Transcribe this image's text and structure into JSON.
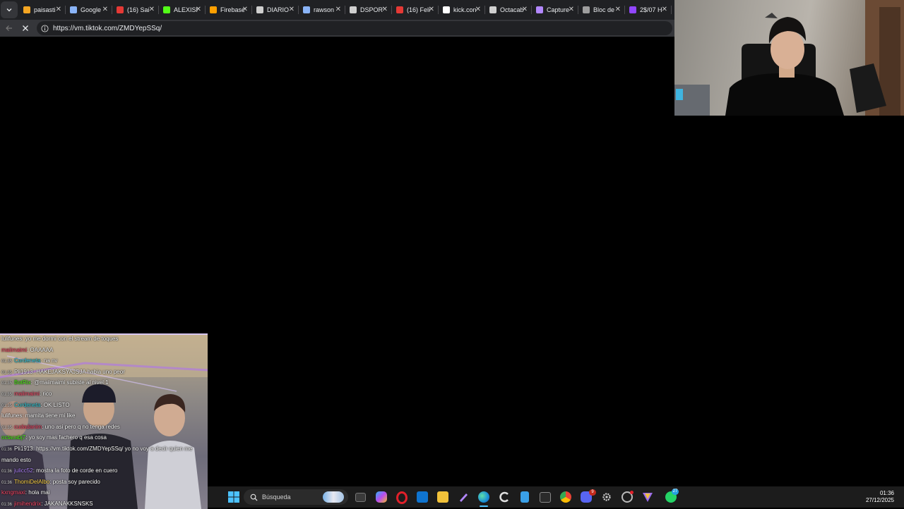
{
  "browser": {
    "tabs": [
      {
        "label": "paisasti",
        "color": "#f5a623"
      },
      {
        "label": "Google",
        "color": "#8ab4f8"
      },
      {
        "label": "(16) Sai",
        "color": "#e53935"
      },
      {
        "label": "ALEXISF",
        "color": "#53fc18"
      },
      {
        "label": "Firebase",
        "color": "#ffa000"
      },
      {
        "label": "DIARIO",
        "color": "#cfcfcf"
      },
      {
        "label": "rawson",
        "color": "#8ab4f8"
      },
      {
        "label": "DSPORT",
        "color": "#cfcfcf"
      },
      {
        "label": "(16) Feli",
        "color": "#e53935"
      },
      {
        "label": "kick.con",
        "color": "#ffffff"
      },
      {
        "label": "Octacab",
        "color": "#cfcfcf"
      },
      {
        "label": "Capture",
        "color": "#b388ff"
      },
      {
        "label": "Bloc de",
        "color": "#9e9e9e"
      },
      {
        "label": "2$/07 H",
        "color": "#9146ff"
      }
    ],
    "url": "https://vm.tiktok.com/ZMDYepSSq/"
  },
  "chat": {
    "messages": [
      {
        "time": "",
        "user": "lulifunes",
        "user_color": "#ffffff",
        "text": ": yo me dormi con el stream de toques"
      },
      {
        "time": "",
        "user": "maiimaimi",
        "user_color": "#ff4d6d",
        "text": ": OAAAAA"
      },
      {
        "time": "01:35",
        "user": "Cordeneta",
        "user_color": "#35d0e0",
        "text": ": na nv"
      },
      {
        "time": "01:35",
        "user": "Pli1913",
        "user_color": "#ffffff",
        "text": ": HAKEJAKSYAJSJA habia uno peor"
      },
      {
        "time": "01:35",
        "user": "BotRix",
        "user_color": "#53fc18",
        "text": ": @maiimaimi subiste al nivel 1"
      },
      {
        "time": "01:35",
        "user": "maiimaimi",
        "user_color": "#ff4d6d",
        "text": ": rico"
      },
      {
        "time": "01:35",
        "user": "Cordeneta",
        "user_color": "#35d0e0",
        "text": ": OK LISTO"
      },
      {
        "time": "",
        "user": "lulifunes",
        "user_color": "#ffffff",
        "text": ": mamita tiene mi like"
      },
      {
        "time": "01:35",
        "user": "cudadanim",
        "user_color": "#ff4d6d",
        "text": ": uno asi pero q no tenga redes"
      },
      {
        "time": "",
        "user": "octacabj7",
        "user_color": "#53fc18",
        "text": ": yo soy mas fachero q esa cosa"
      },
      {
        "time": "01:36",
        "user": "Pli1913",
        "user_color": "#ffffff",
        "text": ": https://vm.tiktok.com/ZMDYepSSq/ yo no voy a decir quien me"
      },
      {
        "time": "",
        "user": "",
        "user_color": "#ffffff",
        "text": "mando esto"
      },
      {
        "time": "01:36",
        "user": "julicc52",
        "user_color": "#b388ff",
        "text": ": mostra la foto de corde en cuero"
      },
      {
        "time": "01:36",
        "user": "ThomiDelAlbo",
        "user_color": "#ffd54f",
        "text": ": posta soy parecido"
      },
      {
        "time": "",
        "user": "kxngmaxi",
        "user_color": "#ff4d6d",
        "text": ": hola mai"
      },
      {
        "time": "01:36",
        "user": "jimihendrix",
        "user_color": "#ff4d6d",
        "text": ": JAKANAKKSNSKS"
      }
    ]
  },
  "taskbar": {
    "search_label": "Búsqueda",
    "time": "01:36",
    "date": "27/12/2025",
    "discord_badge": "9",
    "whatsapp_badge": "27"
  }
}
